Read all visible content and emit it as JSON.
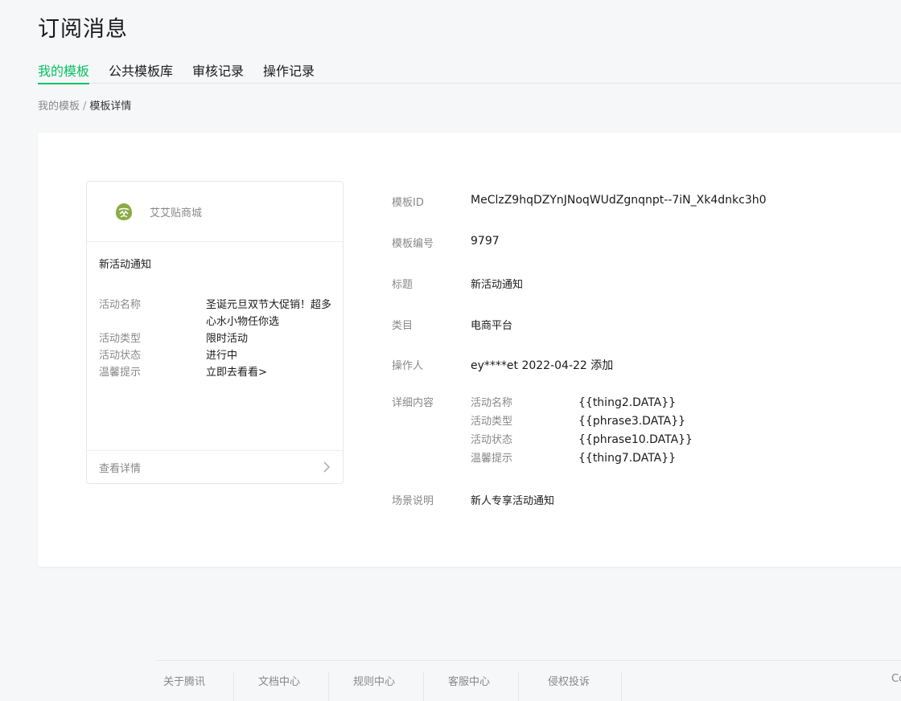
{
  "page": {
    "title": "订阅消息"
  },
  "tabs": [
    {
      "label": "我的模板",
      "active": true
    },
    {
      "label": "公共模板库",
      "active": false
    },
    {
      "label": "审核记录",
      "active": false
    },
    {
      "label": "操作记录",
      "active": false
    }
  ],
  "breadcrumb": {
    "parent": "我的模板",
    "separator": "/",
    "current": "模板详情"
  },
  "preview": {
    "shop_name": "艾艾贴商城",
    "logo_icon": "leaf-logo-icon",
    "message_title": "新活动通知",
    "fields": [
      {
        "key": "活动名称",
        "value": "圣诞元旦双节大促销！超多心水小物任你选"
      },
      {
        "key": "活动类型",
        "value": "限时活动"
      },
      {
        "key": "活动状态",
        "value": "进行中"
      },
      {
        "key": "温馨提示",
        "value": "立即去看看>"
      }
    ],
    "footer_label": "查看详情",
    "footer_icon": "chevron-right-icon"
  },
  "info": {
    "template_id": {
      "label": "模板ID",
      "value": "MeClzZ9hqDZYnJNoqWUdZgnqnpt--7iN_Xk4dnkc3h0"
    },
    "template_no": {
      "label": "模板编号",
      "value": "9797"
    },
    "title": {
      "label": "标题",
      "value": "新活动通知"
    },
    "category": {
      "label": "类目",
      "value": "电商平台"
    },
    "operator": {
      "label": "操作人",
      "value": "ey****et 2022-04-22 添加"
    },
    "details": {
      "label": "详细内容",
      "items": [
        {
          "key": "活动名称",
          "value": "{{thing2.DATA}}"
        },
        {
          "key": "活动类型",
          "value": "{{phrase3.DATA}}"
        },
        {
          "key": "活动状态",
          "value": "{{phrase10.DATA}}"
        },
        {
          "key": "温馨提示",
          "value": "{{thing7.DATA}}"
        }
      ]
    },
    "scene": {
      "label": "场景说明",
      "value": "新人专享活动通知"
    }
  },
  "footer": {
    "links": [
      "关于腾讯",
      "文档中心",
      "规则中心",
      "客服中心",
      "侵权投诉"
    ],
    "copyright": "Co"
  },
  "colors": {
    "accent": "#07c160",
    "logo": "#8aab45"
  }
}
